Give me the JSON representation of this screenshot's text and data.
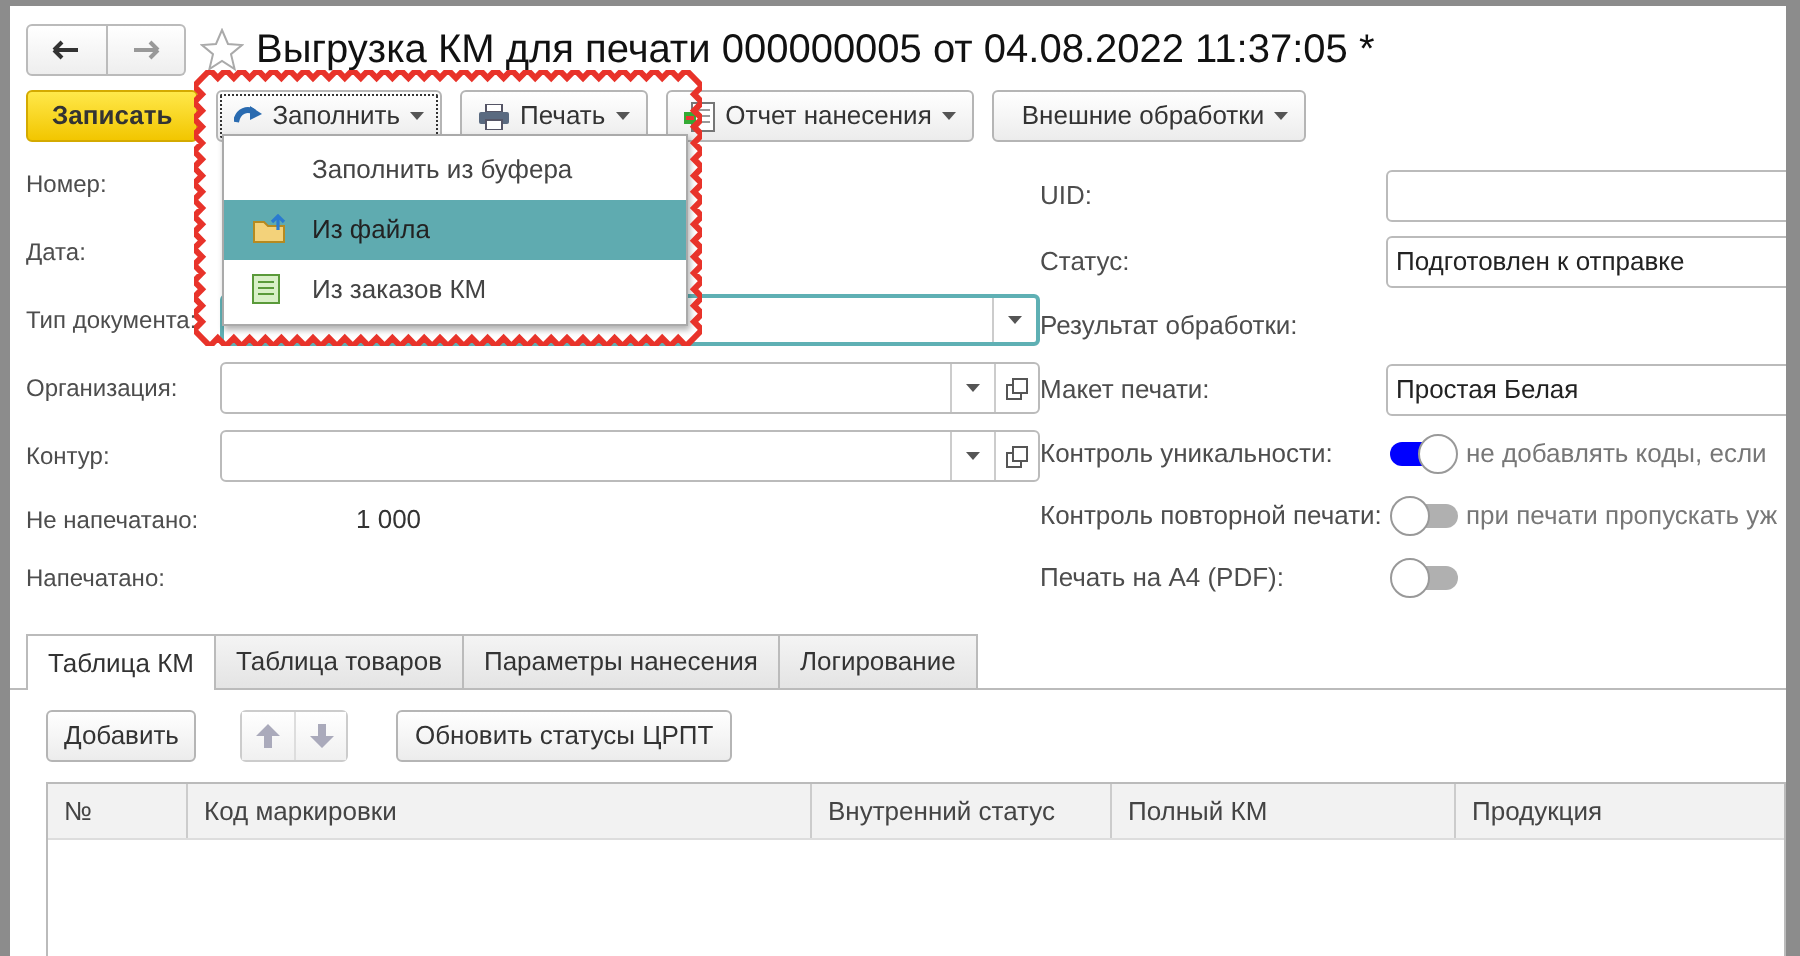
{
  "window": {
    "title": "Выгрузка КМ для печати 000000005 от 04.08.2022 11:37:05 *"
  },
  "toolbar": [
    {
      "label": "Записать",
      "kind": "save"
    },
    {
      "label": "Заполнить",
      "kind": "fill",
      "expanded": true
    },
    {
      "label": "Печать",
      "kind": "print",
      "expanded": false
    },
    {
      "label": "Отчет нанесения",
      "kind": "report",
      "expanded": false
    },
    {
      "label": "Внешние обработки",
      "kind": "plain",
      "expanded": false
    }
  ],
  "fill_menu": [
    {
      "label": "Заполнить из буфера",
      "kind": "none",
      "selected": false
    },
    {
      "label": "Из файла",
      "kind": "folder",
      "selected": true
    },
    {
      "label": "Из заказов КМ",
      "kind": "list",
      "selected": false
    }
  ],
  "left_fields": [
    {
      "label": "Номер:",
      "kind": "hidden"
    },
    {
      "label": "Дата:",
      "kind": "hidden"
    },
    {
      "label": "Тип документа:",
      "kind": "combo",
      "focused": true
    },
    {
      "label": "Организация:",
      "kind": "combo-open",
      "focused": false
    },
    {
      "label": "Контур:",
      "kind": "combo-open",
      "focused": false
    },
    {
      "label": "Не напечатано:",
      "kind": "number",
      "value": "1 000"
    },
    {
      "label": "Напечатано:",
      "kind": "number"
    }
  ],
  "right_fields": [
    {
      "label": "UID:",
      "kind": "input"
    },
    {
      "label": "Статус:",
      "kind": "input",
      "value": "Подготовлен к отправке"
    },
    {
      "label": "Результат обработки:",
      "kind": "text"
    },
    {
      "label": "Макет печати:",
      "kind": "input",
      "value": "Простая Белая"
    },
    {
      "label": "Контроль уникальности:",
      "kind": "toggle",
      "on": true,
      "hint": "не добавлять коды, если"
    },
    {
      "label": "Контроль повторной печати:",
      "kind": "toggle",
      "on": false,
      "hint": "при печати пропускать уж"
    },
    {
      "label": "Печать на А4 (PDF):",
      "kind": "toggle",
      "on": false
    }
  ],
  "tabs": [
    {
      "label": "Таблица КМ",
      "selected": true
    },
    {
      "label": "Таблица товаров",
      "selected": false
    },
    {
      "label": "Параметры нанесения",
      "selected": false
    },
    {
      "label": "Логирование",
      "selected": false
    }
  ],
  "table_toolbar": [
    {
      "kind": "button",
      "label": "Добавить"
    },
    {
      "kind": "move-up",
      "disabled": true
    },
    {
      "kind": "move-down",
      "disabled": true
    },
    {
      "kind": "button",
      "label": "Обновить статусы ЦРПТ"
    }
  ],
  "table": {
    "columns": [
      "№",
      "Код маркировки",
      "Внутренний статус",
      "Полный КМ",
      "Продукция"
    ]
  }
}
